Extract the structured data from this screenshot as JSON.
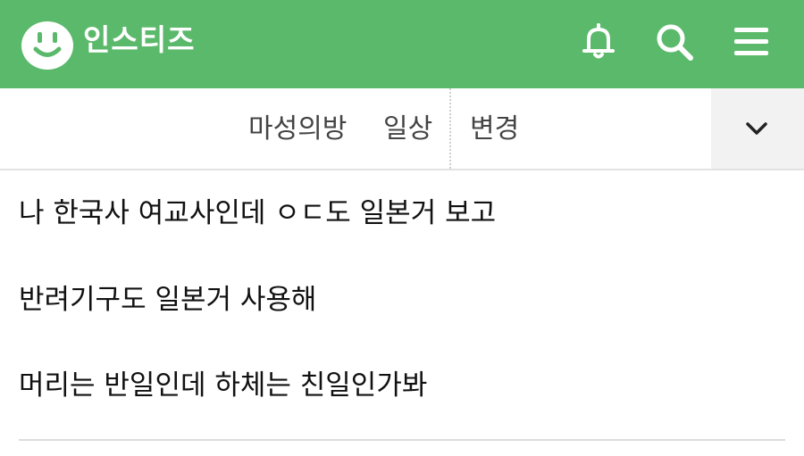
{
  "header": {
    "brand": "인스티즈",
    "icons": [
      "smiley-logo-icon",
      "bell-icon",
      "search-icon",
      "hamburger-menu-icon"
    ],
    "accent_color": "#5bb96b"
  },
  "category_bar": {
    "board": "마성의방",
    "subcategory": "일상",
    "change_label": "변경",
    "dropdown_icon": "chevron-down-icon"
  },
  "post": {
    "lines": [
      "나 한국사 여교사인데 ㅇㄷ도 일본거 보고",
      "반려기구도 일본거 사용해",
      "머리는 반일인데 하체는 친일인가봐"
    ]
  }
}
